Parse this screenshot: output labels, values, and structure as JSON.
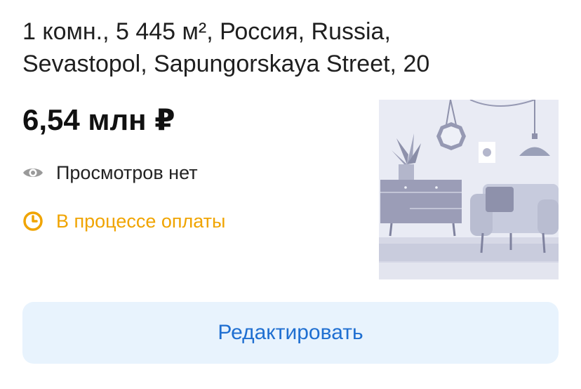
{
  "listing": {
    "title": "1 комн., 5 445 м², Россия, Russia, Sevastopol, Sapungorskaya Street, 20",
    "price": "6,54 млн ₽",
    "views_text": "Просмотров нет",
    "status_text": "В процессе оплаты",
    "icons": {
      "views": "eye-icon",
      "status": "clock-icon"
    }
  },
  "actions": {
    "edit_label": "Редактировать"
  },
  "colors": {
    "status": "#f0a400",
    "button_bg": "#e8f3fd",
    "button_text": "#1f6fd1",
    "muted_icon": "#9a9a9a"
  }
}
